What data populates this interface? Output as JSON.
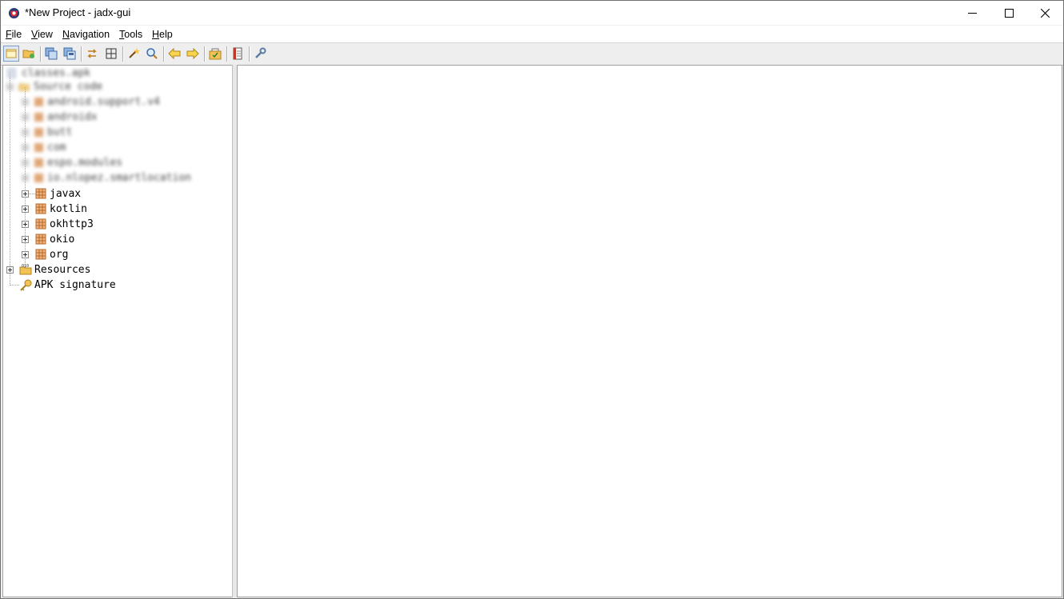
{
  "window": {
    "title": "*New Project - jadx-gui"
  },
  "menu": {
    "items": [
      {
        "mnemonic": "F",
        "rest": "ile"
      },
      {
        "mnemonic": "V",
        "rest": "iew"
      },
      {
        "mnemonic": "N",
        "rest": "avigation"
      },
      {
        "mnemonic": "T",
        "rest": "ools"
      },
      {
        "mnemonic": "H",
        "rest": "elp"
      }
    ]
  },
  "toolbar": {
    "icons": [
      "new-project-icon",
      "open-file-icon",
      "save-all-icon",
      "export-icon",
      "sync-icon",
      "flatten-packages-icon",
      "text-search-icon",
      "class-search-icon",
      "back-icon",
      "forward-icon",
      "deobfuscation-icon",
      "log-viewer-icon",
      "preferences-icon"
    ]
  },
  "tree": {
    "root": "classes.apk",
    "source_code": "Source code",
    "blurred_packages": [
      "android.support.v4",
      "androidx",
      "butt",
      "com",
      "espo.modules",
      "io.nlopez.smartlocation"
    ],
    "packages": [
      "javax",
      "kotlin",
      "okhttp3",
      "okio",
      "org"
    ],
    "resources": "Resources",
    "apk_signature": "APK signature"
  },
  "colors": {
    "package_icon": "#d4894a",
    "folder_icon": "#f3c254",
    "key_icon": "#e3b23c",
    "title_bar": "#ffffff",
    "toolbar": "#eeeeee"
  }
}
